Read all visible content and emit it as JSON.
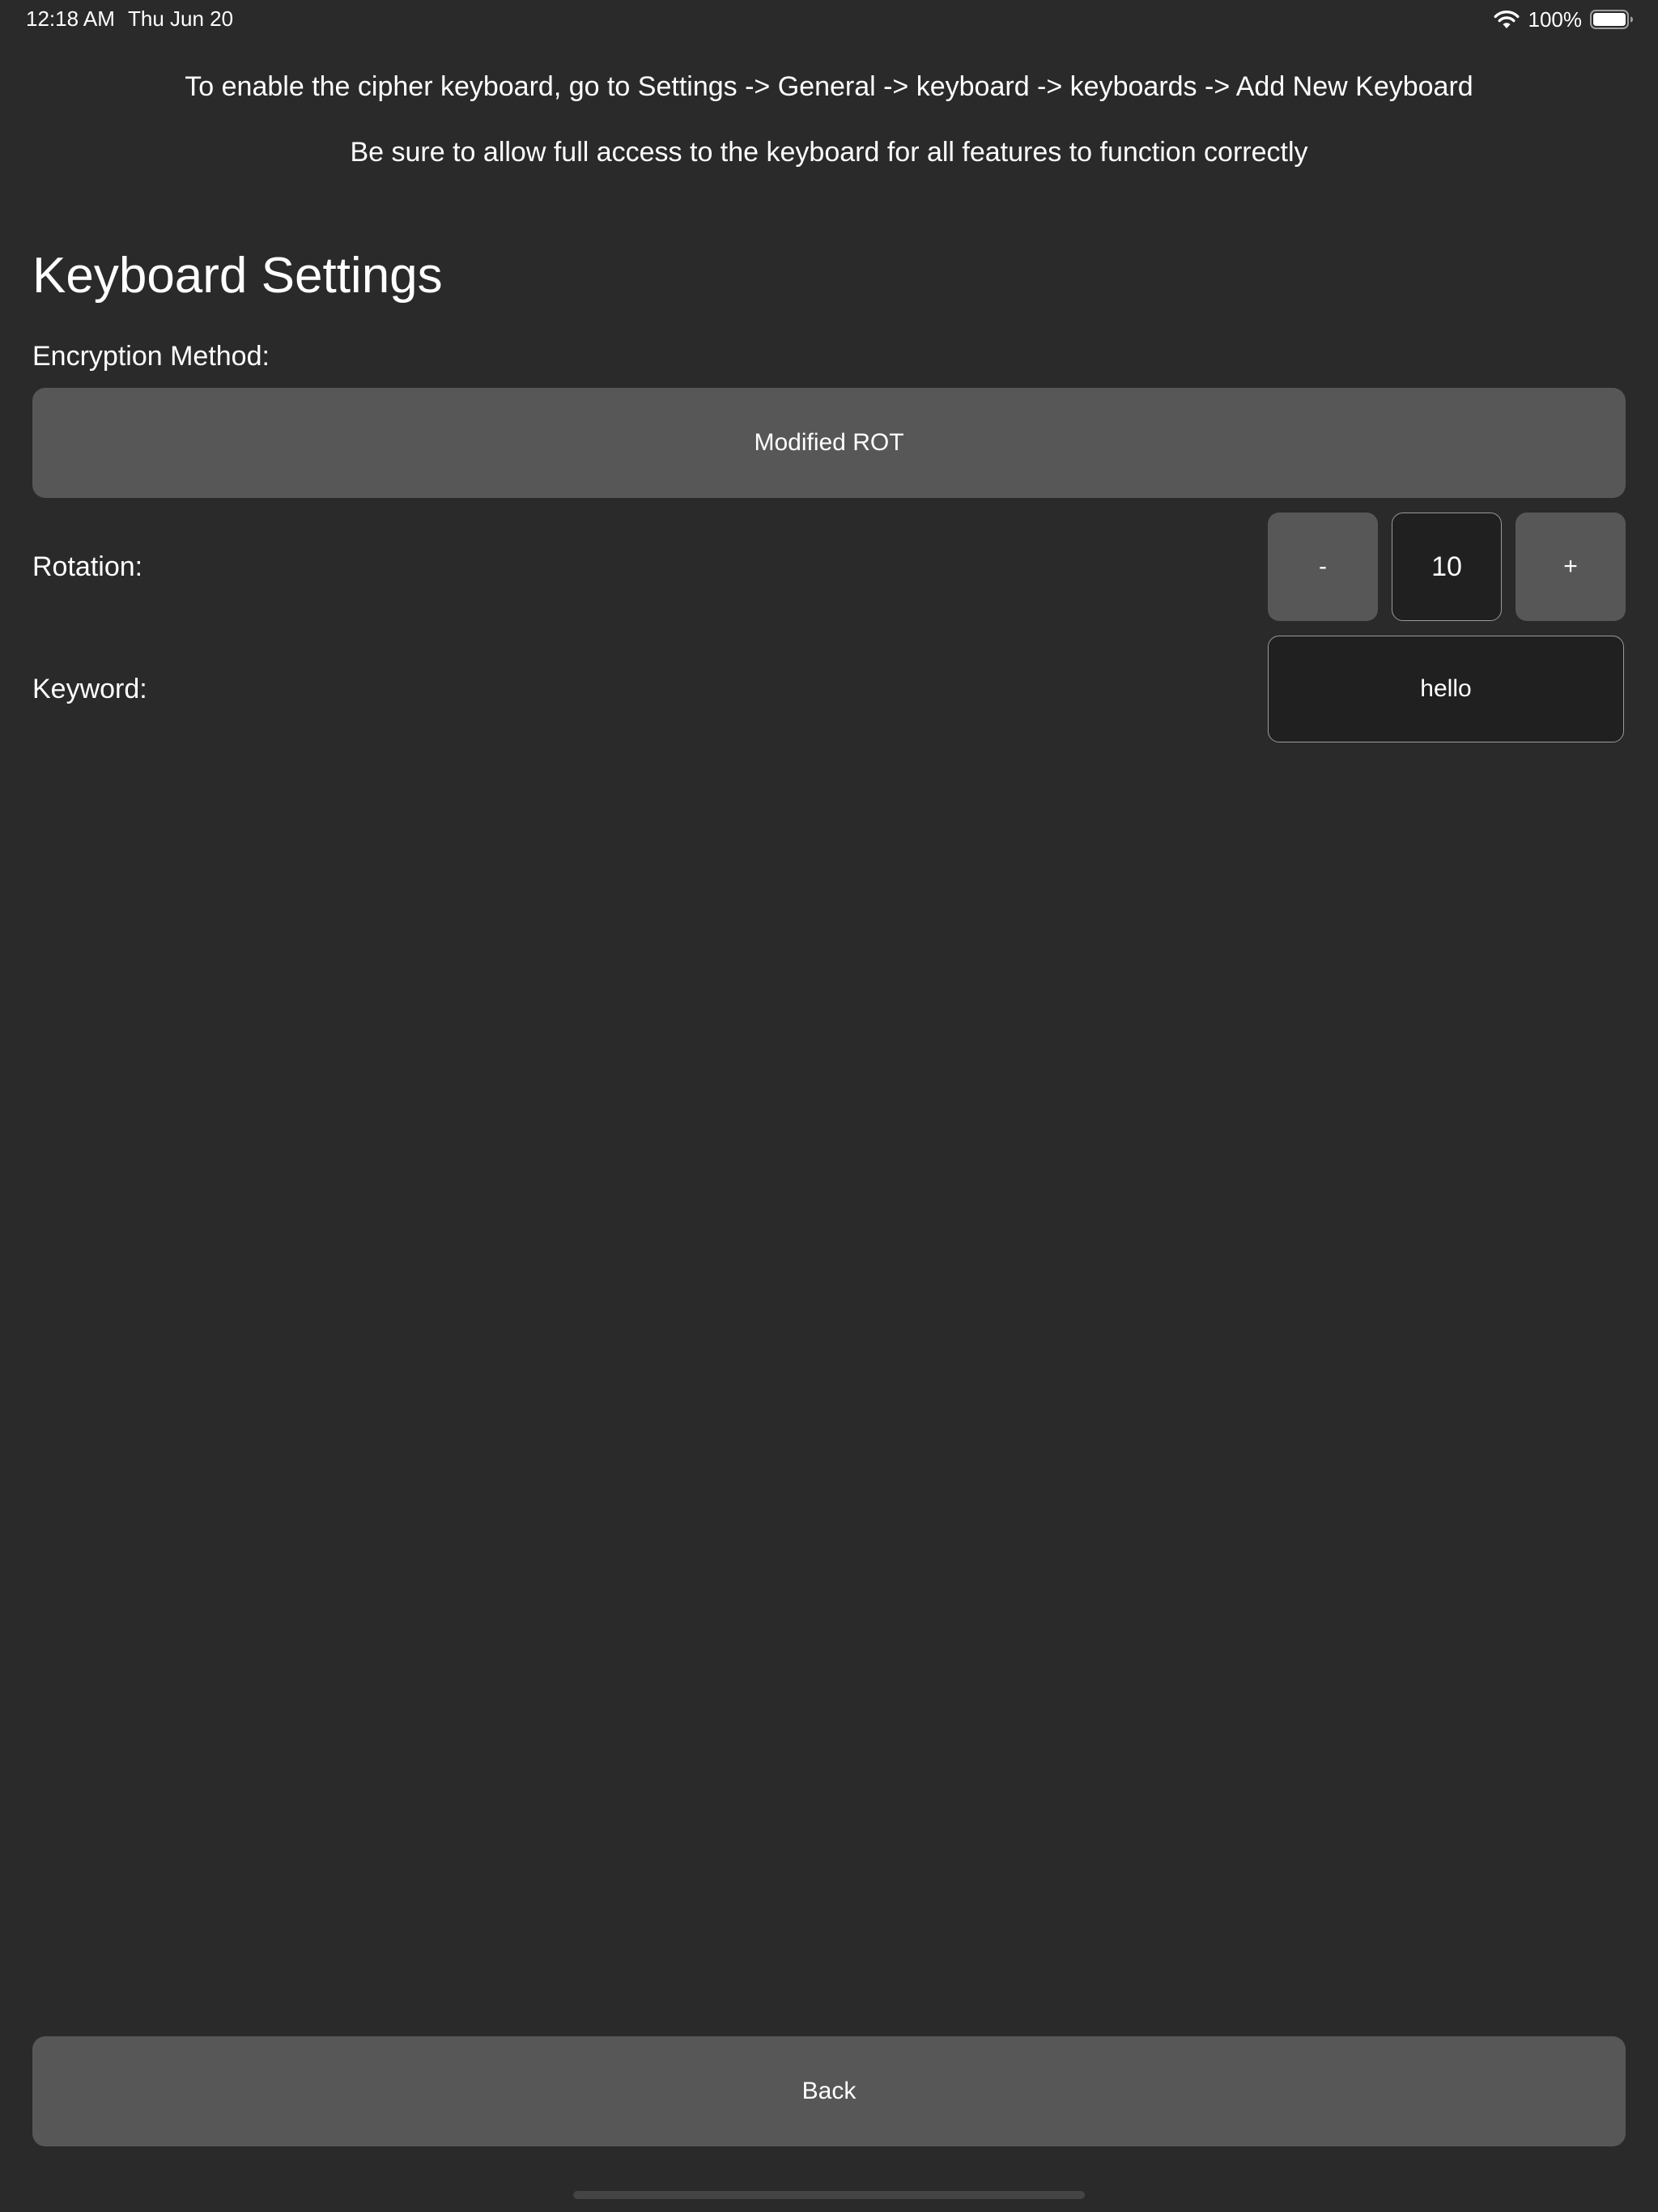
{
  "status_bar": {
    "time": "12:18 AM",
    "date": "Thu Jun 20",
    "battery": "100%"
  },
  "instructions": {
    "line1": "To enable the cipher keyboard, go to Settings -> General -> keyboard -> keyboards -> Add New Keyboard",
    "line2": "Be sure to allow full access to the keyboard for all features to function correctly"
  },
  "settings": {
    "title": "Keyboard Settings",
    "encryption_label": "Encryption Method:",
    "encryption_value": "Modified ROT",
    "rotation_label": "Rotation:",
    "rotation_minus": "-",
    "rotation_value": "10",
    "rotation_plus": "+",
    "keyword_label": "Keyword:",
    "keyword_value": "hello"
  },
  "footer": {
    "back_label": "Back"
  },
  "icons": {
    "wifi": "wifi-icon",
    "battery": "battery-icon"
  },
  "colors": {
    "background": "#2a2a2a",
    "button": "#575757",
    "field": "#202020",
    "field_border": "#9a9a9a",
    "text": "#ffffff"
  }
}
